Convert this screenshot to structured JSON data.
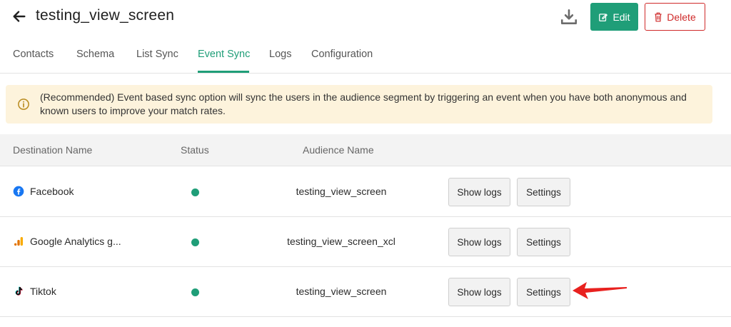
{
  "header": {
    "title": "testing_view_screen",
    "edit_label": "Edit",
    "delete_label": "Delete"
  },
  "tabs": [
    {
      "label": "Contacts"
    },
    {
      "label": "Schema"
    },
    {
      "label": "List Sync"
    },
    {
      "label": "Event Sync"
    },
    {
      "label": "Logs"
    },
    {
      "label": "Configuration"
    }
  ],
  "active_tab": "Event Sync",
  "banner": {
    "text": "(Recommended) Event based sync option will sync the users in the audience segment by triggering an event when you have both anonymous and known users to improve your match rates."
  },
  "table": {
    "headers": {
      "destination": "Destination Name",
      "status": "Status",
      "audience": "Audience Name"
    },
    "rows": [
      {
        "destination": "Facebook",
        "icon": "facebook-icon",
        "status": "active",
        "audience": "testing_view_screen",
        "logs_label": "Show logs",
        "settings_label": "Settings"
      },
      {
        "destination": "Google Analytics g...",
        "icon": "google-analytics-icon",
        "status": "active",
        "audience": "testing_view_screen_xcl",
        "logs_label": "Show logs",
        "settings_label": "Settings"
      },
      {
        "destination": "Tiktok",
        "icon": "tiktok-icon",
        "status": "active",
        "audience": "testing_view_screen",
        "logs_label": "Show logs",
        "settings_label": "Settings"
      }
    ]
  },
  "colors": {
    "accent": "#1f9e78",
    "danger": "#cf2a2a",
    "banner_bg": "#fdf3dc",
    "annotation_arrow": "#e8211f"
  }
}
